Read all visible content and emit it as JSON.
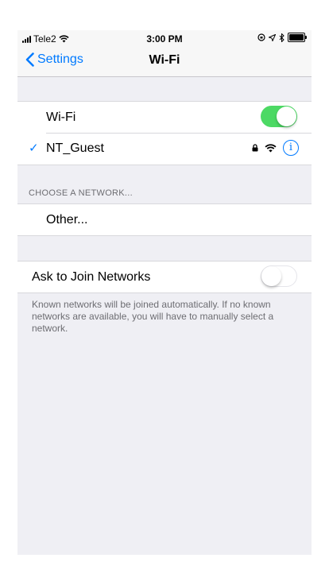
{
  "status_bar": {
    "carrier": "Tele2",
    "time": "3:00 PM",
    "icons": [
      "signal-icon",
      "wifi-icon",
      "location-lock-icon",
      "location-arrow-icon",
      "bluetooth-icon",
      "battery-icon"
    ]
  },
  "navbar": {
    "back_label": "Settings",
    "title": "Wi-Fi"
  },
  "wifi": {
    "label": "Wi-Fi",
    "enabled": true,
    "toggle_color": "#4cd964"
  },
  "connected_network": {
    "name": "NT_Guest",
    "secured": true,
    "icons": [
      "checkmark-icon",
      "lock-icon",
      "wifi-signal-icon",
      "info-icon"
    ]
  },
  "networks_section": {
    "header": "CHOOSE A NETWORK...",
    "other_label": "Other..."
  },
  "ask_to_join": {
    "label": "Ask to Join Networks",
    "enabled": false,
    "footer": "Known networks will be joined automatically. If no known networks are available, you will have to manually select a network."
  },
  "colors": {
    "accent": "#007aff",
    "background": "#efeff4"
  }
}
